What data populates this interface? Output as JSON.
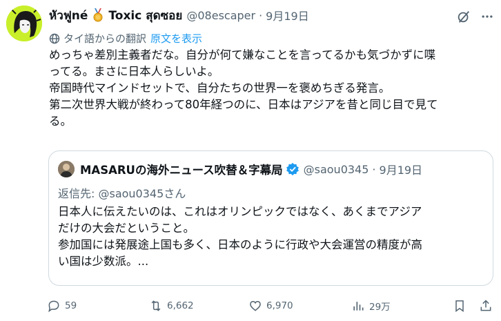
{
  "tweet": {
    "author_name": "หัวฟูné",
    "author_name_2": "Toxic สุดซอย",
    "handle": "@08escaper",
    "separator": "·",
    "date": "9月19日",
    "translation_note": "タイ語からの翻訳",
    "show_original": "原文を表示",
    "text_lines": [
      "めっちゃ差別主義者だな。自分が何て嫌なことを言ってるかも気づかずに喋",
      "ってる。まさに日本人らしいよ。",
      "帝国時代マインドセットで、自分たちの世界一を褒めちぎる発言。",
      "第二次世界大戦が終わって80年経つのに、日本はアジアを昔と同じ目で見て",
      "る。"
    ]
  },
  "quote": {
    "author_name": "MASARUの海外ニュース吹替＆字幕局",
    "handle": "@saou0345",
    "separator": "·",
    "date": "9月19日",
    "reply_to": "返信先: @saou0345さん",
    "text_lines": [
      "日本人に伝えたいのは、これはオリンピックではなく、あくまでアジア",
      "だけの大会だということ。",
      "参加国には発展途上国も多く、日本のように行政や大会運営の精度が高",
      "い国は少数派。..."
    ]
  },
  "actions": {
    "replies": "59",
    "retweets": "6,662",
    "likes": "6,970",
    "views": "29万"
  },
  "icons": {
    "grok": "grok-icon",
    "more": "more-icon",
    "translate": "globe-icon",
    "verified": "verified-badge-icon",
    "reply": "reply-icon",
    "retweet": "retweet-icon",
    "like": "heart-icon",
    "views": "views-icon",
    "bookmark": "bookmark-icon",
    "share": "share-icon"
  },
  "colors": {
    "text": "#0f1419",
    "secondary": "#536471",
    "link": "#1d9bf0",
    "border": "#cfd9de",
    "avatar_bg": "#c8ef2a"
  }
}
